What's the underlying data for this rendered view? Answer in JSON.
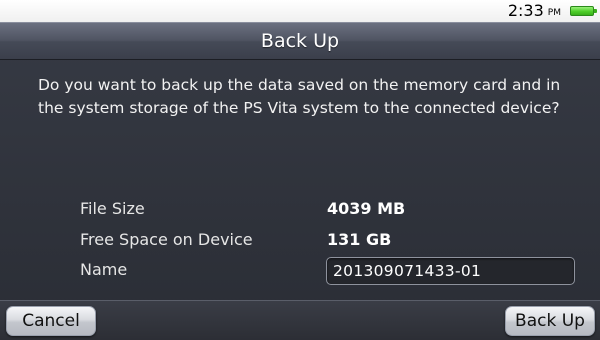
{
  "status_bar": {
    "time": "2:33",
    "ampm": "PM",
    "battery_icon": "battery-full-icon",
    "battery_color": "#4fcf2a"
  },
  "dialog": {
    "title": "Back Up",
    "message": "Do you want to back up the data saved on the memory card and in the system storage of the PS Vita system to the connected device?"
  },
  "info": {
    "file_size": {
      "label": "File Size",
      "value": "4039 MB"
    },
    "free_space": {
      "label": "Free Space on Device",
      "value": "131 GB"
    },
    "name": {
      "label": "Name",
      "value": "201309071433-01"
    }
  },
  "buttons": {
    "cancel": "Cancel",
    "backup": "Back Up"
  }
}
